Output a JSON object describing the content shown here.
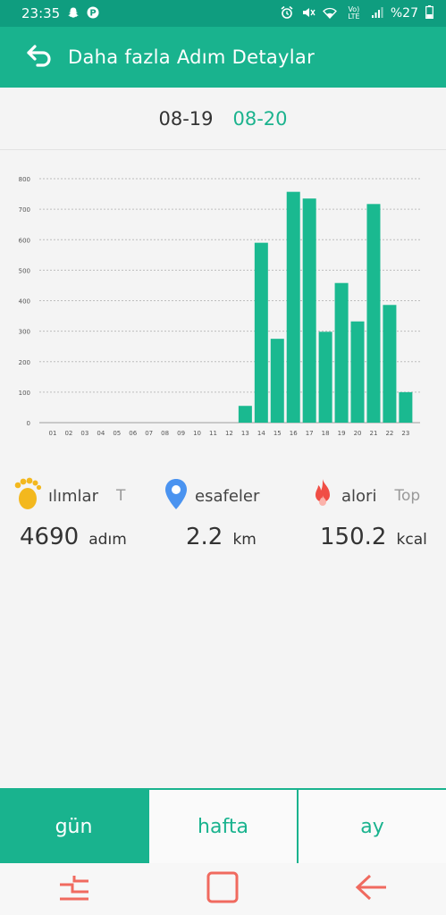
{
  "status_bar": {
    "time": "23:35",
    "lte": "Vo) LTE",
    "battery_text": "%27"
  },
  "header": {
    "title": "Daha fazla Adım Detaylar",
    "back_icon": "arrow-back-icon"
  },
  "dates": {
    "previous": "08-19",
    "current": "08-20"
  },
  "colors": {
    "accent": "#19b38e",
    "bar": "#1ab990",
    "status_bar": "#0f9d7f",
    "nav_icon": "#f06a5f"
  },
  "chart_data": {
    "type": "bar",
    "categories": [
      "01",
      "02",
      "03",
      "04",
      "05",
      "06",
      "07",
      "08",
      "09",
      "10",
      "11",
      "12",
      "13",
      "14",
      "15",
      "16",
      "17",
      "18",
      "19",
      "20",
      "21",
      "22",
      "23"
    ],
    "values": [
      0,
      0,
      0,
      0,
      0,
      0,
      0,
      0,
      0,
      0,
      0,
      0,
      55,
      590,
      275,
      757,
      735,
      298,
      458,
      332,
      717,
      386,
      100
    ],
    "y_ticks": [
      "0",
      "100",
      "200",
      "300",
      "400",
      "500",
      "600",
      "700",
      "800"
    ],
    "ylim": [
      0,
      800
    ],
    "grid": true
  },
  "stats": {
    "steps": {
      "label": "ılımlar",
      "extra": "T",
      "value": "4690",
      "unit": "adım",
      "icon": "footprint-icon"
    },
    "distance": {
      "label": "esafeler",
      "value": "2.2",
      "unit": "km",
      "icon": "location-pin-icon"
    },
    "calories": {
      "label": "alori",
      "extra": "Top",
      "value": "150.2",
      "unit": "kcal",
      "icon": "flame-icon"
    }
  },
  "tabs": [
    {
      "label": "gün",
      "active": true
    },
    {
      "label": "hafta",
      "active": false
    },
    {
      "label": "ay",
      "active": false
    }
  ]
}
